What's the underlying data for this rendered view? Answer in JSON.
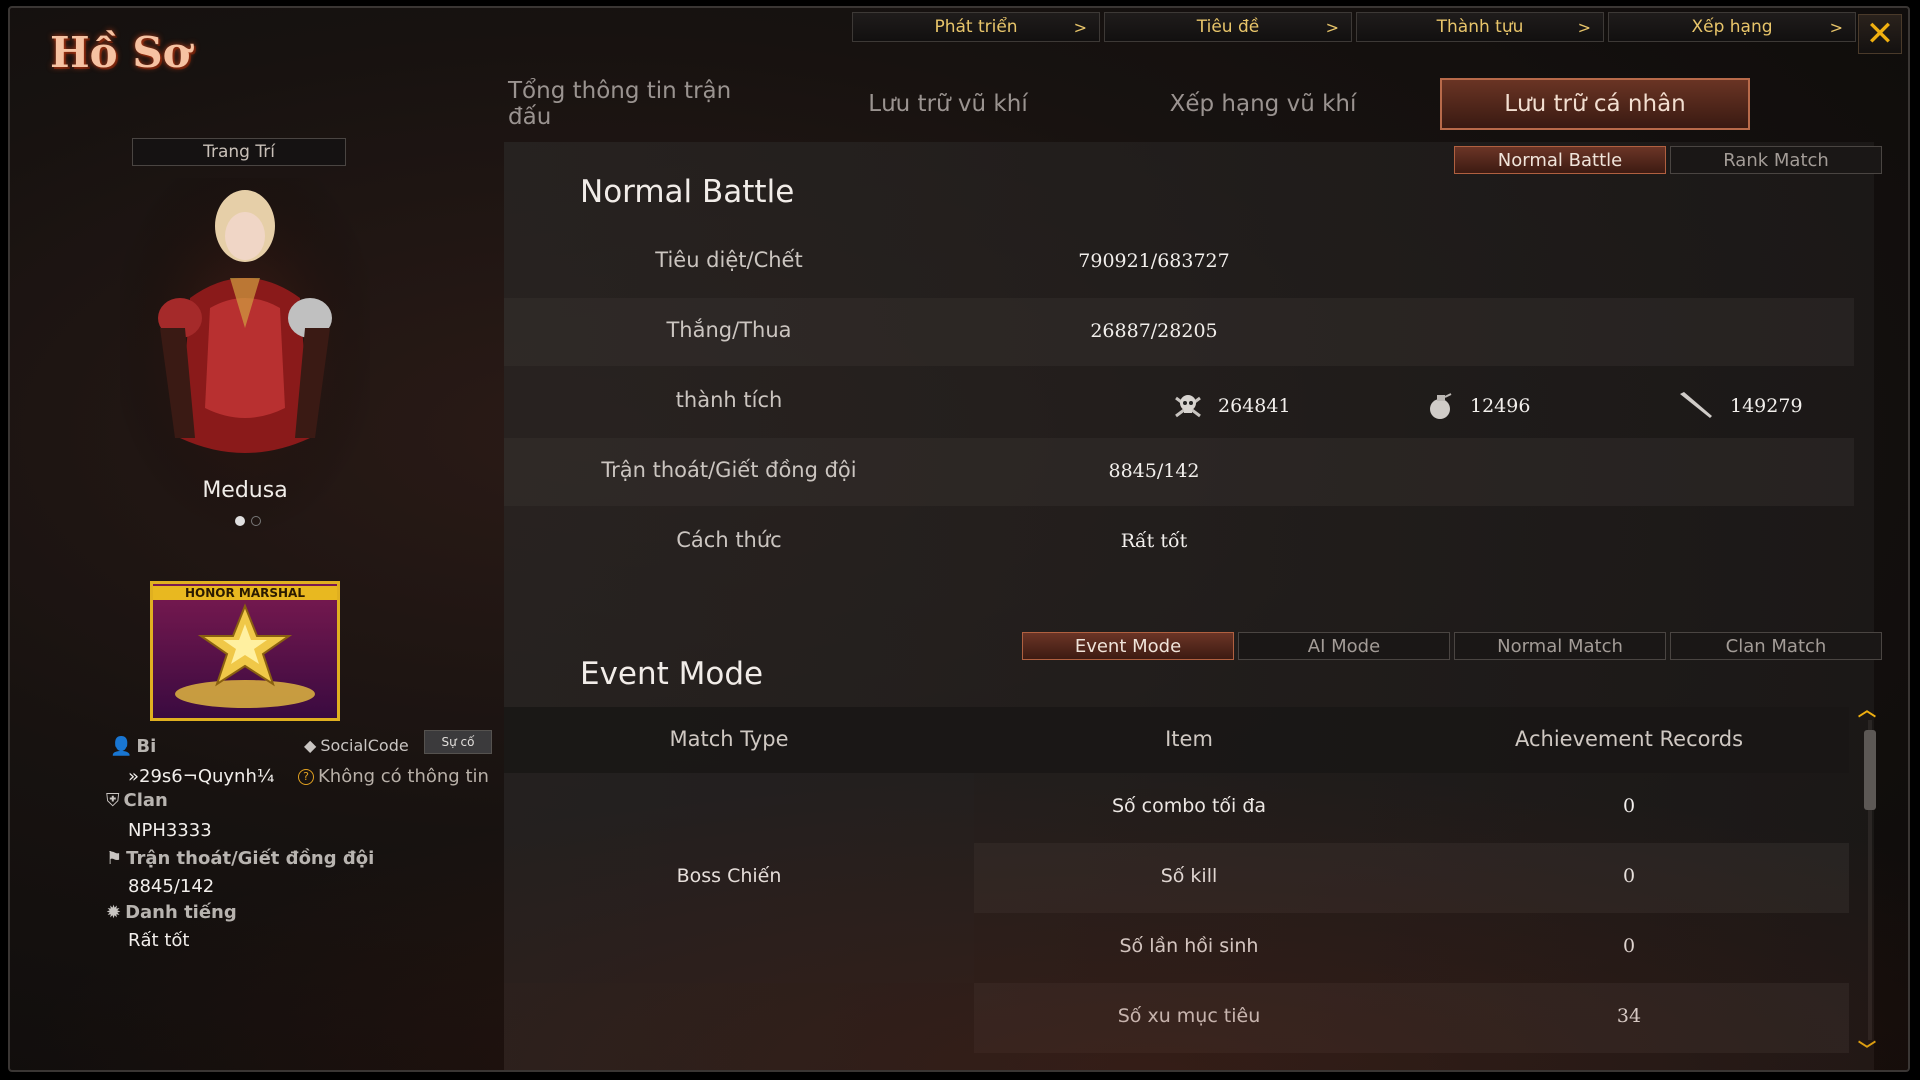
{
  "app_title": "Hồ Sơ",
  "top_nav": [
    {
      "label": "Phát triển",
      "chevron": ">"
    },
    {
      "label": "Tiêu đề",
      "chevron": ">"
    },
    {
      "label": "Thành tựu",
      "chevron": ">"
    },
    {
      "label": "Xếp hạng",
      "chevron": ">"
    }
  ],
  "close_glyph": "✕",
  "main_tabs": [
    "Tổng thông tin trận đấu",
    "Lưu trữ vũ khí",
    "Xếp hạng vũ khí",
    "Lưu trữ cá nhân"
  ],
  "main_tab_active": "Lưu trữ cá nhân",
  "left": {
    "deco_button": "Trang Trí",
    "character_name": "Medusa",
    "badge_label": "HONOR MARSHAL",
    "player_name_label": "Bi",
    "social_code_label": "SocialCode",
    "su_co_button": "Sự cố",
    "player_id": "»29s6¬Quynh¼",
    "no_info": "Không có thông tin",
    "clan_label": "Clan",
    "clan_value": "NPH3333",
    "desert_label": "Trận thoát/Giết đồng đội",
    "desert_value": "8845/142",
    "rep_label": "Danh tiếng",
    "rep_value": "Rất tốt"
  },
  "normal_battle": {
    "title": "Normal Battle",
    "tabs": [
      "Normal Battle",
      "Rank Match"
    ],
    "active_tab": "Normal Battle",
    "rows": [
      {
        "label": "Tiêu diệt/Chết",
        "value": "790921/683727"
      },
      {
        "label": "Thắng/Thua",
        "value": "26887/28205"
      },
      {
        "label": "thành tích",
        "value": ""
      },
      {
        "label": "Trận thoát/Giết đồng đội",
        "value": "8845/142"
      },
      {
        "label": "Cách thức",
        "value": "Rất tốt"
      }
    ],
    "achievements": [
      {
        "icon": "skull-icon",
        "value": "264841"
      },
      {
        "icon": "grenade-icon",
        "value": "12496"
      },
      {
        "icon": "knife-icon",
        "value": "149279"
      }
    ]
  },
  "event_mode": {
    "title": "Event Mode",
    "tabs": [
      "Event Mode",
      "AI Mode",
      "Normal Match",
      "Clan Match"
    ],
    "active_tab": "Event Mode",
    "headers": [
      "Match Type",
      "Item",
      "Achievement Records"
    ],
    "match_type": "Boss Chiến",
    "rows": [
      {
        "item": "Số combo tối đa",
        "record": "0"
      },
      {
        "item": "Số kill",
        "record": "0"
      },
      {
        "item": "Số lần hồi sinh",
        "record": "0"
      },
      {
        "item": "Số xu mục tiêu",
        "record": "34"
      }
    ]
  },
  "colors": {
    "accent_gold": "#e8c56a",
    "active_tab": "#6a3424",
    "close_x": "#f0b010"
  }
}
